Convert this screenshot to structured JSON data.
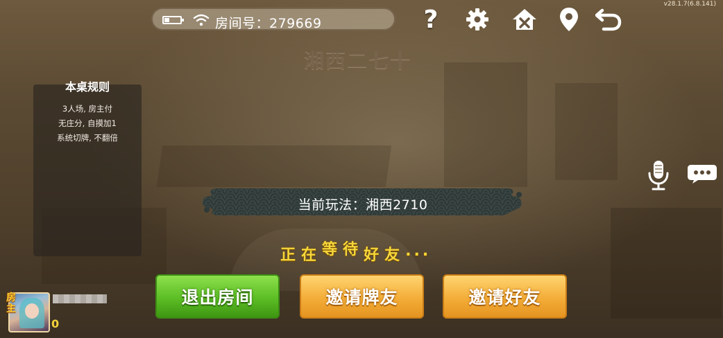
{
  "top_bar": {
    "room_label": "房间号：279669"
  },
  "version": "v28.1.7(6.8.141)",
  "game_title": "湘西二七十",
  "rules": {
    "title": "本桌规则",
    "lines": [
      "3人场, 房主付",
      "无庄分, 自摸加1",
      "系统切牌, 不翻倍"
    ]
  },
  "mode_banner": "当前玩法：湘西2710",
  "waiting": {
    "chars": [
      "正",
      "在",
      "等",
      "待",
      "好",
      "友",
      ".",
      ".",
      "."
    ]
  },
  "buttons": {
    "exit": "退出房间",
    "invite_card_friend": "邀请牌友",
    "invite_friend": "邀请好友"
  },
  "player": {
    "host_badge": "房主",
    "score": "0"
  },
  "colors": {
    "green_button": "#5cbd25",
    "orange_button": "#f3ad38",
    "waiting_text": "#f5d73a",
    "banner": "#34403d"
  },
  "icons": [
    "battery-icon",
    "wifi-icon",
    "help-icon",
    "gear-icon",
    "home-icon",
    "location-icon",
    "back-icon",
    "microphone-icon",
    "chat-icon"
  ]
}
